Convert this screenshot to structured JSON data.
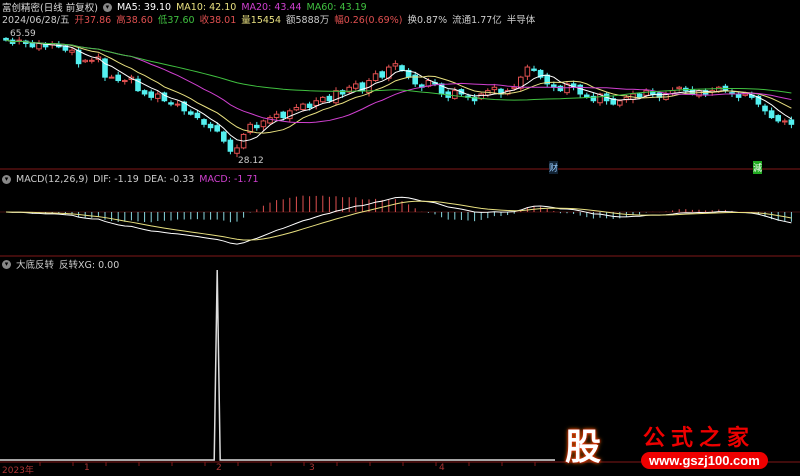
{
  "header": {
    "title": "富创精密(日线 前复权)",
    "ma5": "MA5: 39.10",
    "ma10": "MA10: 42.10",
    "ma20": "MA20: 43.44",
    "ma60": "MA60: 43.19"
  },
  "quote": {
    "date": "2024/06/28/五",
    "open": "开37.86",
    "high": "高38.60",
    "low": "低37.60",
    "close": "收38.01",
    "volume": "量15454",
    "amount": "额5888万",
    "change": "幅0.26(0.69%)",
    "turnover": "换0.87%",
    "float": "流通1.77亿",
    "sector": "半导体"
  },
  "price_labels": {
    "high": "65.59",
    "low": "28.12"
  },
  "markers": {
    "cai": "财",
    "jian": "減"
  },
  "macd": {
    "title": "MACD(12,26,9)",
    "dif": "DIF: -1.19",
    "dea": "DEA: -0.33",
    "macd": "MACD: -1.71"
  },
  "indicator": {
    "title": "大底反转",
    "xg": "反转XG: 0.00"
  },
  "axis": {
    "labels": [
      "2023年",
      "1",
      "2",
      "3",
      "4"
    ]
  },
  "watermark": {
    "brand": "股",
    "name": "公式之家",
    "url": "www.gszj100.com"
  },
  "colors": {
    "up": "#e05050",
    "down": "#54f0f0",
    "ma5": "#ffffff",
    "ma10": "#e8e080",
    "ma20": "#d040d0",
    "ma60": "#40c040",
    "grid": "#801818"
  },
  "closes": [
    63,
    62,
    63,
    62,
    61,
    62,
    61,
    62,
    61,
    60,
    60,
    56,
    57,
    57,
    58,
    52,
    52,
    51,
    51,
    52,
    48,
    47,
    46,
    47,
    45,
    44,
    44,
    42,
    41,
    40,
    38,
    37,
    36,
    33,
    30,
    31,
    35,
    38,
    37,
    39,
    40,
    41,
    40,
    42,
    43,
    44,
    43,
    45,
    46,
    45,
    48,
    47,
    49,
    50,
    48,
    51,
    53,
    52,
    55,
    56,
    54,
    52,
    50,
    49,
    51,
    50,
    47,
    46,
    48,
    47,
    46,
    45,
    47,
    48,
    49,
    47,
    48,
    49,
    52,
    55,
    54,
    52,
    50,
    49,
    48,
    50,
    49,
    47,
    46,
    45,
    47,
    45,
    44,
    45,
    46,
    47,
    46,
    48,
    47,
    46,
    47,
    48,
    49,
    48,
    47,
    48,
    47,
    48,
    49,
    48,
    47,
    46,
    47,
    46,
    44,
    42,
    40,
    39,
    39,
    38
  ],
  "signal_bar_index": 32
}
